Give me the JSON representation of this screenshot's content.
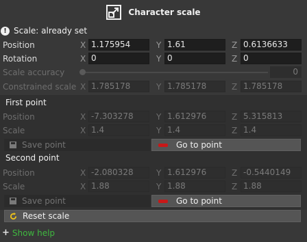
{
  "header": {
    "title": "Character scale",
    "icon": "resize-icon"
  },
  "status": {
    "text": "Scale: already set",
    "icon": "info-icon"
  },
  "axes": {
    "x": "X",
    "y": "Y",
    "z": "Z"
  },
  "transform": {
    "position": {
      "label": "Position",
      "x": "1.175954",
      "y": "1.61",
      "z": "0.6136633"
    },
    "rotation": {
      "label": "Rotation",
      "x": "0",
      "y": "0",
      "z": "0"
    },
    "scale_accuracy": {
      "label": "Scale accuracy",
      "value": "0",
      "level": 0
    },
    "constrained_scale": {
      "label": "Constrained scale",
      "x": "1.785178",
      "y": "1.785178",
      "z": "1.785178"
    }
  },
  "first_point": {
    "title": "First point",
    "position": {
      "label": "Position",
      "x": "-7.303278",
      "y": "1.612976",
      "z": "5.315813"
    },
    "scale": {
      "label": "Scale",
      "x": "1.4",
      "y": "1.4",
      "z": "1.4"
    },
    "save_label": "Save point",
    "goto_label": "Go to point"
  },
  "second_point": {
    "title": "Second point",
    "position": {
      "label": "Position",
      "x": "-2.080328",
      "y": "1.612976",
      "z": "-0.5440149"
    },
    "scale": {
      "label": "Scale",
      "x": "1.88",
      "y": "1.88",
      "z": "1.88"
    },
    "save_label": "Save point",
    "goto_label": "Go to point"
  },
  "reset_label": "Reset scale",
  "help": {
    "plus": "+",
    "label": "Show help"
  },
  "colors": {
    "accent_red": "#c81818",
    "help_green": "#3fb83f",
    "reset_yellow": "#f0c419"
  }
}
